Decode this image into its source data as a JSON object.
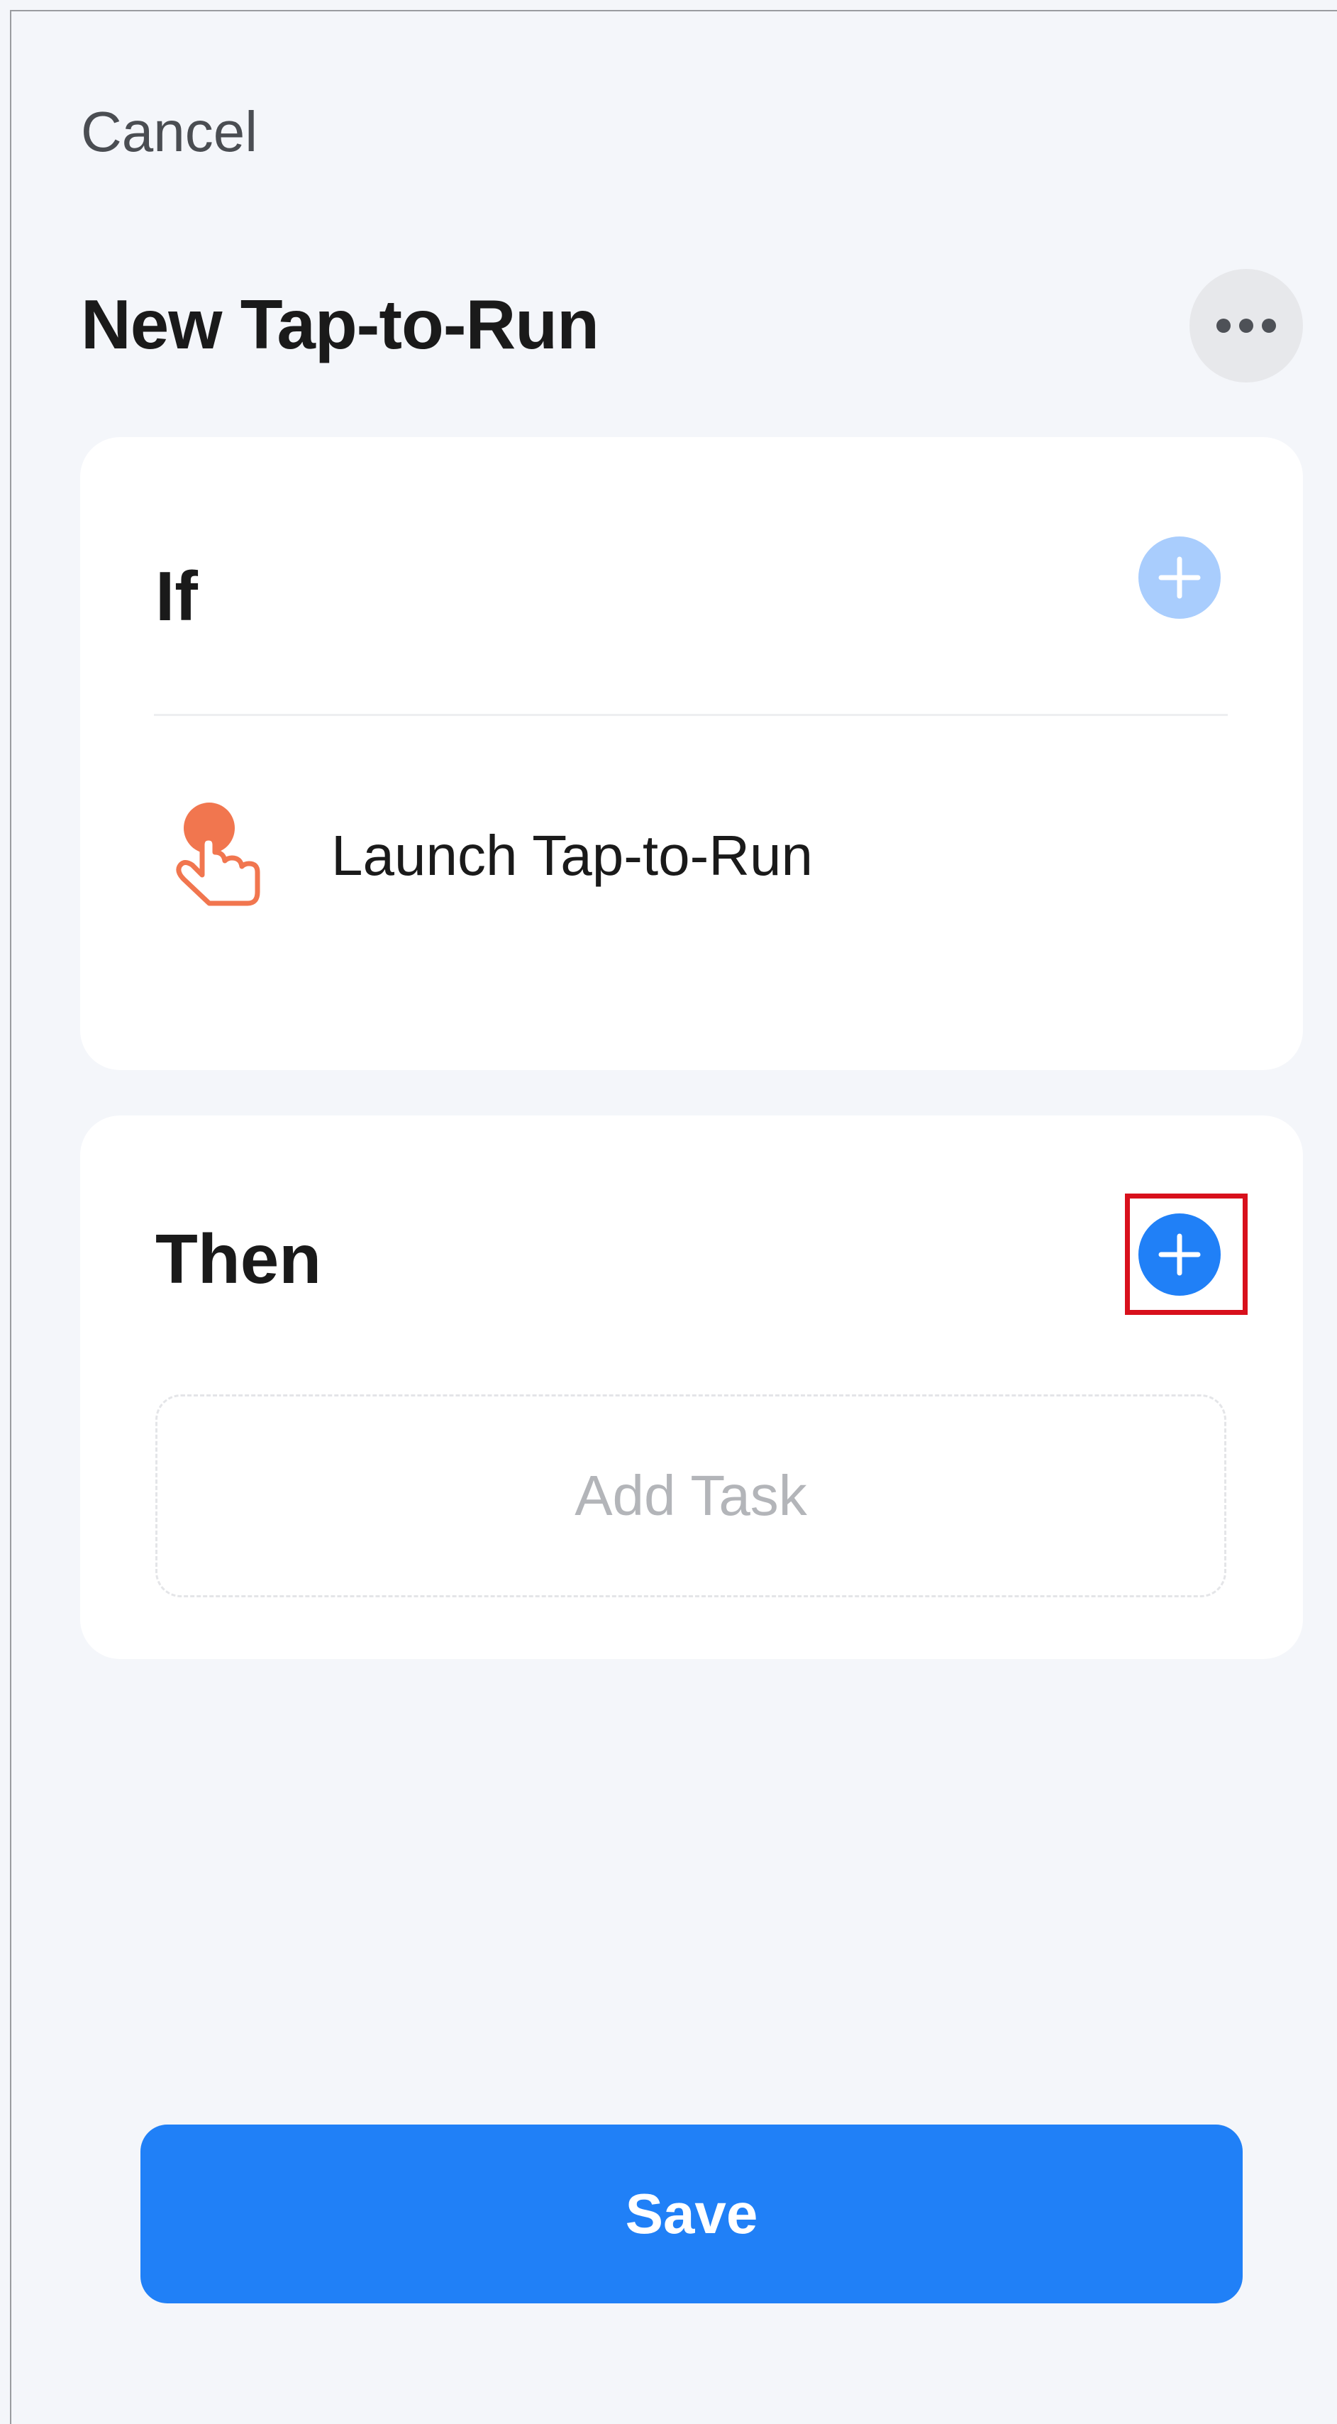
{
  "header": {
    "cancel_label": "Cancel",
    "title": "New Tap-to-Run",
    "more_icon": "more-horizontal-icon"
  },
  "if_section": {
    "heading": "If",
    "add_icon": "plus-icon",
    "conditions": [
      {
        "icon": "tap-hand-icon",
        "label": "Launch Tap-to-Run"
      }
    ]
  },
  "then_section": {
    "heading": "Then",
    "add_icon": "plus-icon",
    "placeholder": "Add Task"
  },
  "footer": {
    "save_label": "Save"
  },
  "colors": {
    "background": "#f4f6fa",
    "accent": "#2080f7",
    "accent_light": "#a9cdfd",
    "icon_orange": "#f1764f",
    "highlight": "#d8101c"
  }
}
